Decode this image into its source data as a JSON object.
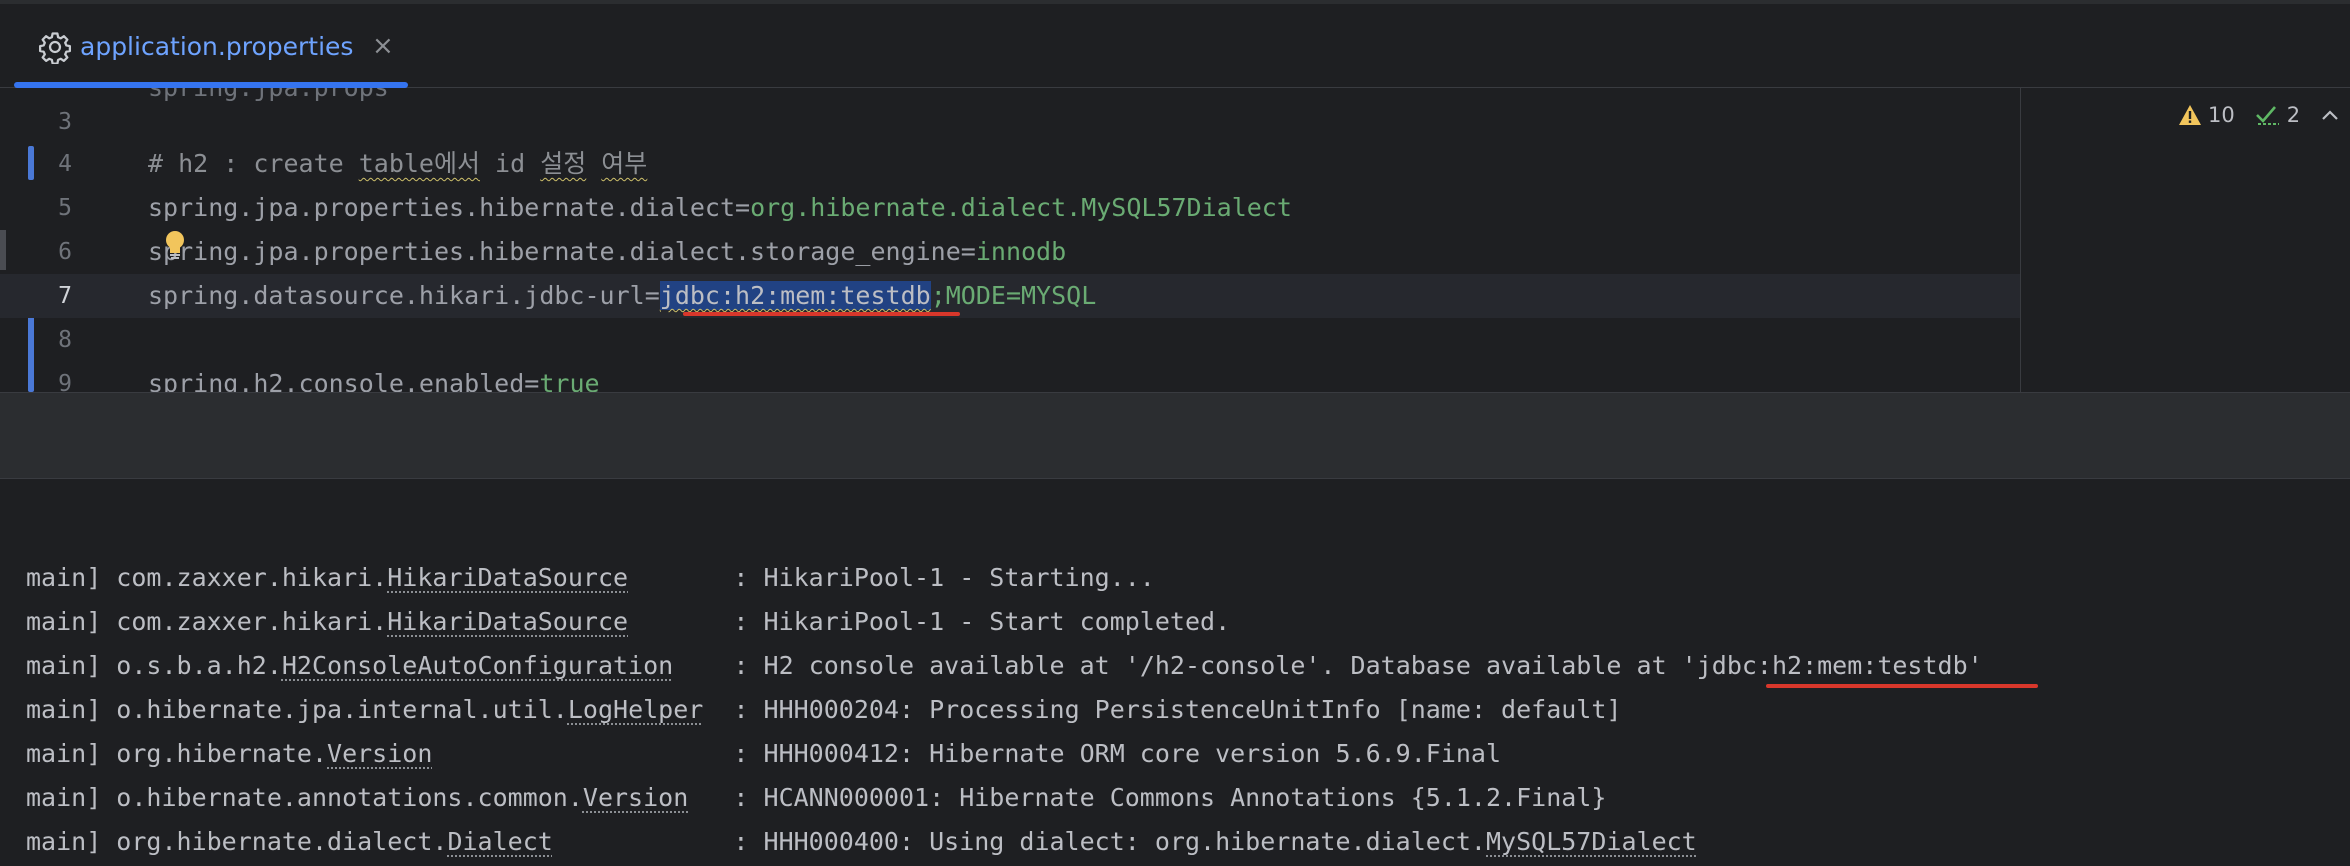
{
  "tab": {
    "icon": "gear-icon",
    "label": "application.properties",
    "close_glyph": "×"
  },
  "inspections": {
    "warnings": "10",
    "ok": "2"
  },
  "editor": {
    "lines": [
      {
        "num": "3"
      },
      {
        "num": "4",
        "comment": "# h2 : create ",
        "w1": "table에서",
        "mid": " id ",
        "w2": "설정",
        "sp": " ",
        "w3": "여부"
      },
      {
        "num": "5",
        "key": "spring.jpa.properties.hibernate.dialect",
        "eq": "=",
        "value": "org.hibernate.dialect.MySQL57Dialect"
      },
      {
        "num": "6",
        "key": "spring.jpa.properties.hibernate.dialect.storage_engine",
        "eq": "=",
        "value": "innodb"
      },
      {
        "num": "7",
        "key": "spring.datasource.hikari.jdbc-url",
        "eq": "=",
        "selected": "jdbc:h2:mem:testdb",
        "rest": ";MODE=MYSQL"
      },
      {
        "num": "8"
      },
      {
        "num": "9",
        "key": "spring.h2.console.enabled",
        "eq": "=",
        "value": "true"
      }
    ]
  },
  "console": {
    "lines": [
      {
        "prefix": "main] com.zaxxer.hikari.",
        "cls": "HikariDataSource",
        "pad": "       ",
        "msg": ": HikariPool-1 - Starting..."
      },
      {
        "prefix": "main] com.zaxxer.hikari.",
        "cls": "HikariDataSource",
        "pad": "       ",
        "msg": ": HikariPool-1 - Start completed."
      },
      {
        "prefix": "main] o.s.b.a.h2.",
        "cls": "H2ConsoleAutoConfiguration",
        "pad": "    ",
        "msg": ": H2 console available at '/h2-console'. Database available at '",
        "url": "jdbc:h2:mem:testdb",
        "tail": "'"
      },
      {
        "prefix": "main] o.hibernate.jpa.internal.util.",
        "cls": "LogHelper",
        "pad": "  ",
        "msg": ": HHH000204: Processing PersistenceUnitInfo [name: default]"
      },
      {
        "prefix": "main] org.hibernate.",
        "cls": "Version",
        "pad": "                    ",
        "msg": ": HHH000412: Hibernate ORM core version 5.6.9.Final"
      },
      {
        "prefix": "main] o.hibernate.annotations.common.",
        "cls": "Version",
        "pad": "   ",
        "msg": ": HCANN000001: Hibernate Commons Annotations {5.1.2.Final}"
      },
      {
        "prefix": "main] org.hibernate.dialect.",
        "cls": "Dialect",
        "pad": "            ",
        "msg": ": HHH000400: Using dialect: org.hibernate.dialect.",
        "cls2": "MySQL57Dialect"
      }
    ]
  }
}
